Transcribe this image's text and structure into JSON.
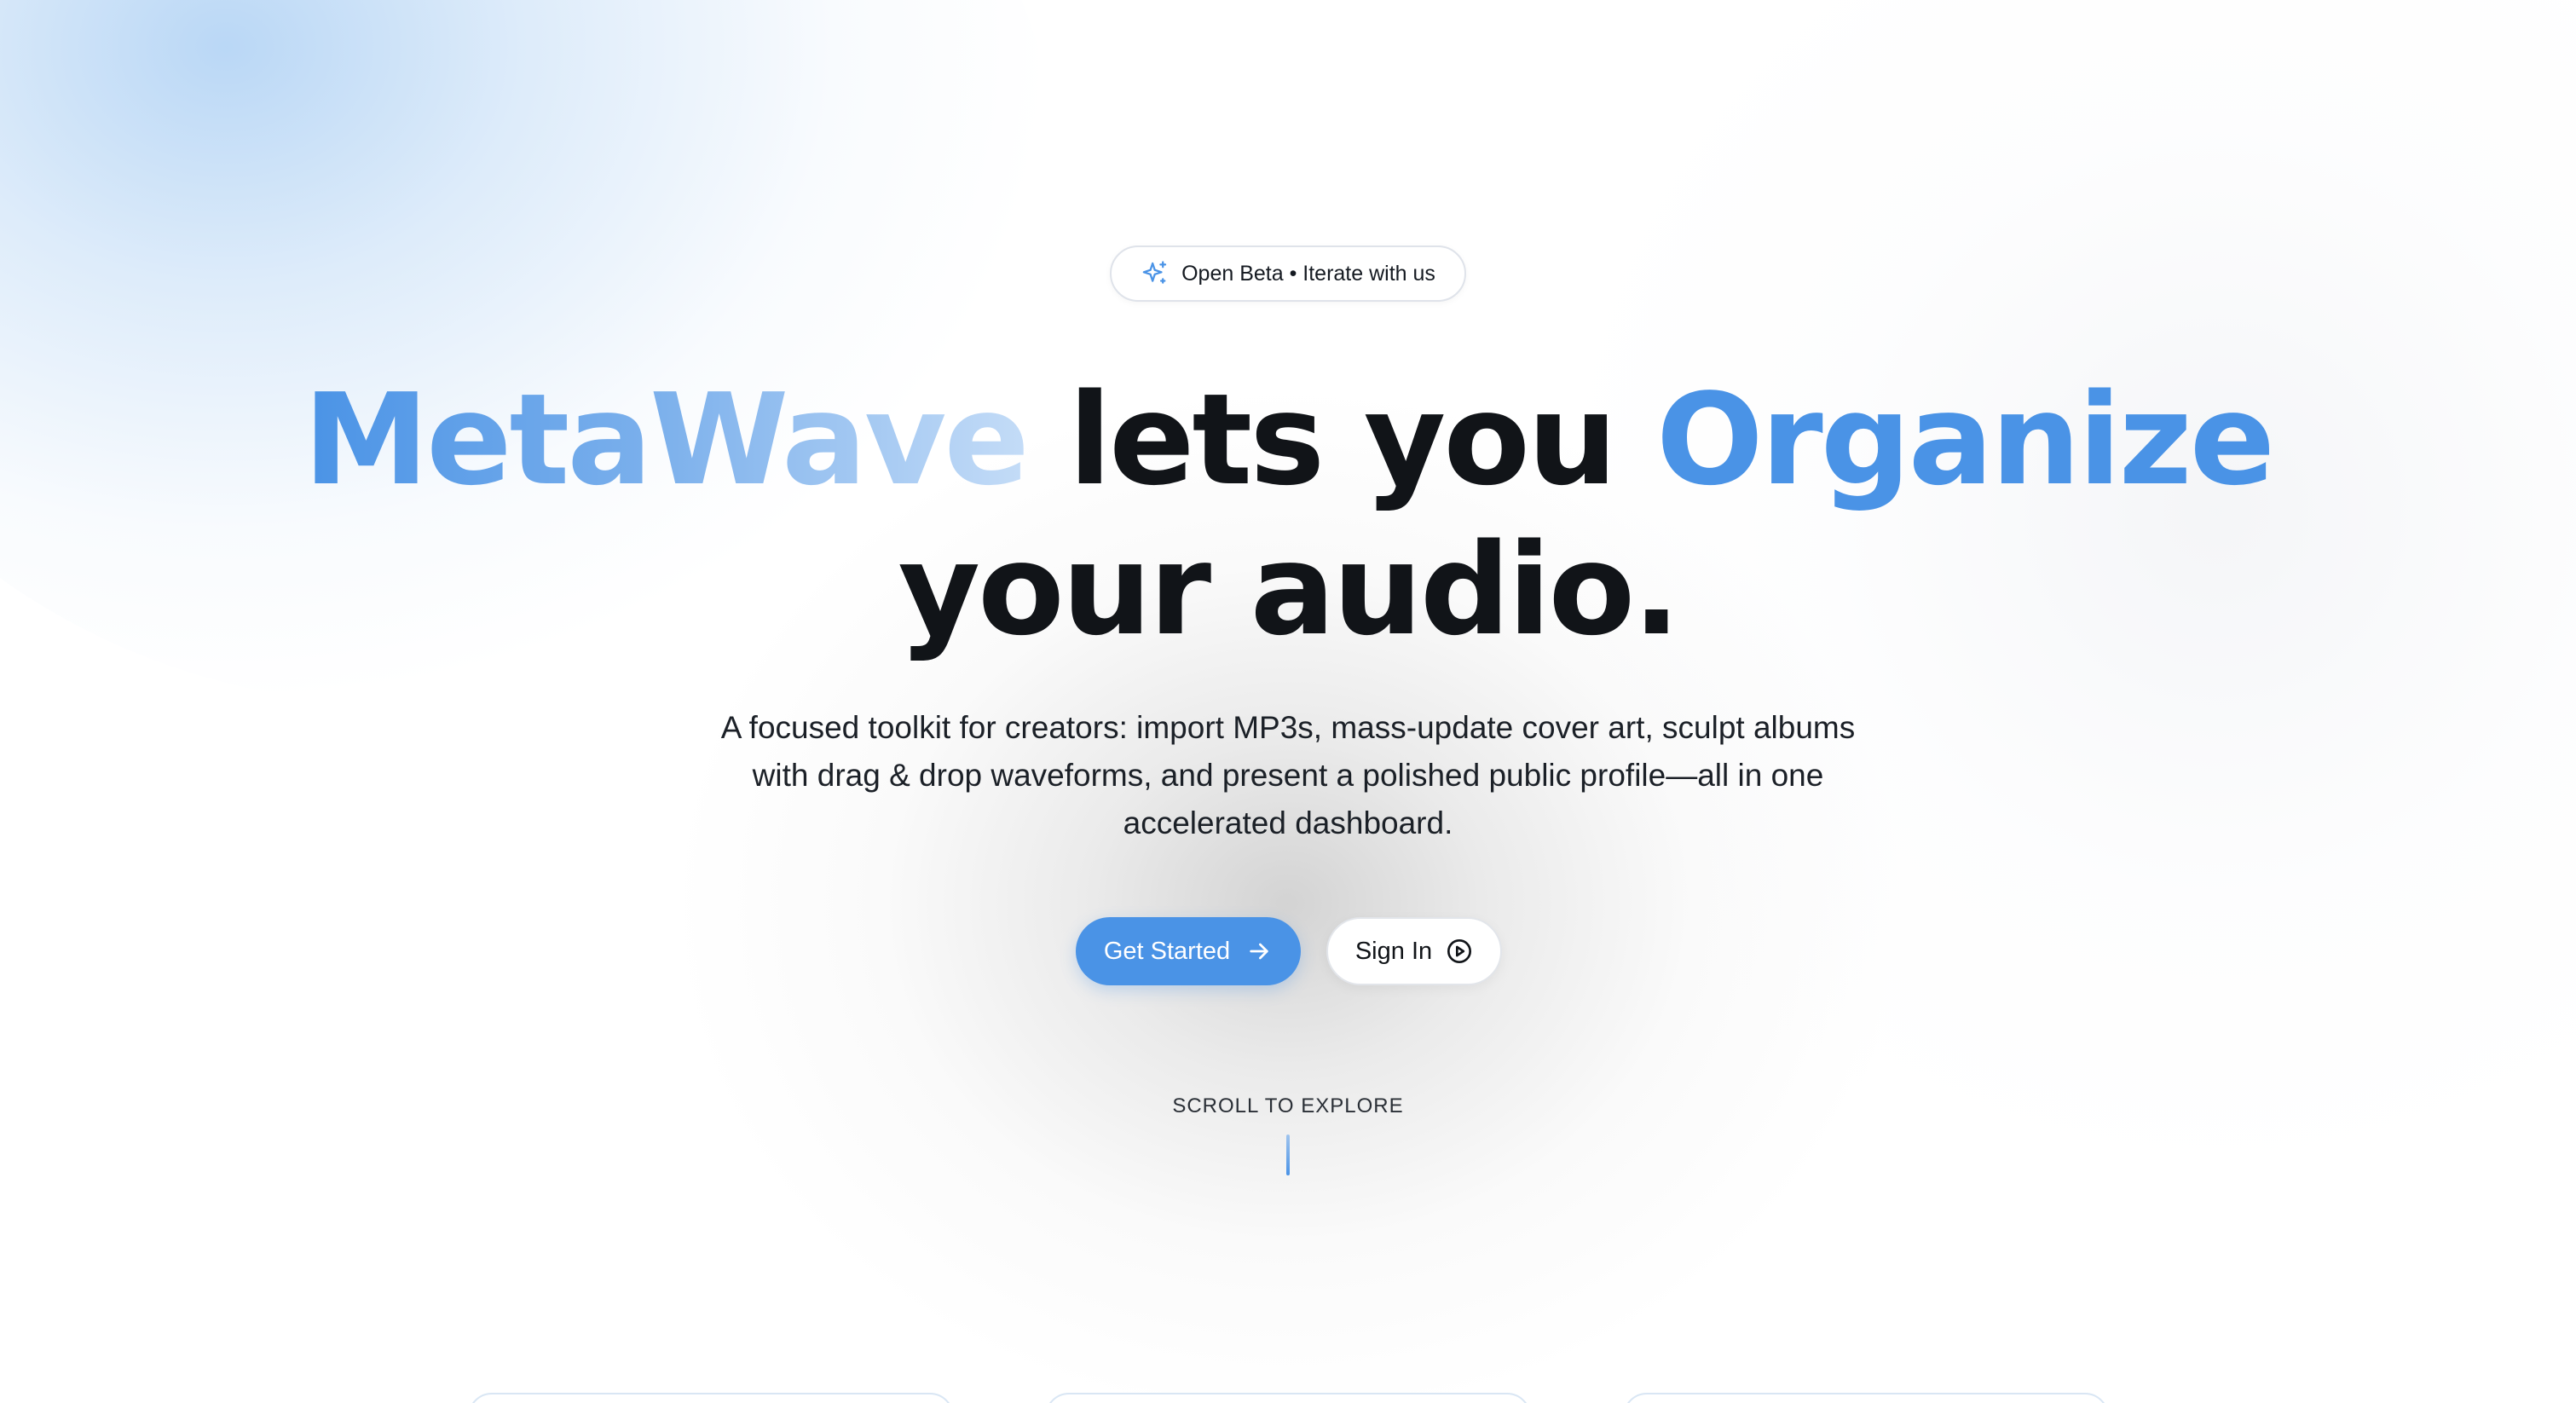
{
  "hero": {
    "badge": {
      "icon": "sparkles-icon",
      "text": "Open Beta • Iterate with us"
    },
    "headline": {
      "brand": "MetaWave",
      "middle": " lets you ",
      "accent": "Organize",
      "line2": "your audio."
    },
    "description": "A focused toolkit for creators: import MP3s, mass-update cover art, sculpt albums with drag & drop waveforms, and present a polished public profile—all in one accelerated dashboard.",
    "primary_button": {
      "label": "Get Started",
      "icon": "arrow-right-icon"
    },
    "secondary_button": {
      "label": "Sign In",
      "icon": "play-circle-icon"
    },
    "scroll_hint": "SCROLL TO EXPLORE"
  },
  "colors": {
    "accent": "#4a93e6",
    "text": "#111418",
    "background": "#ffffff",
    "card_border": "#d9e6f4"
  }
}
